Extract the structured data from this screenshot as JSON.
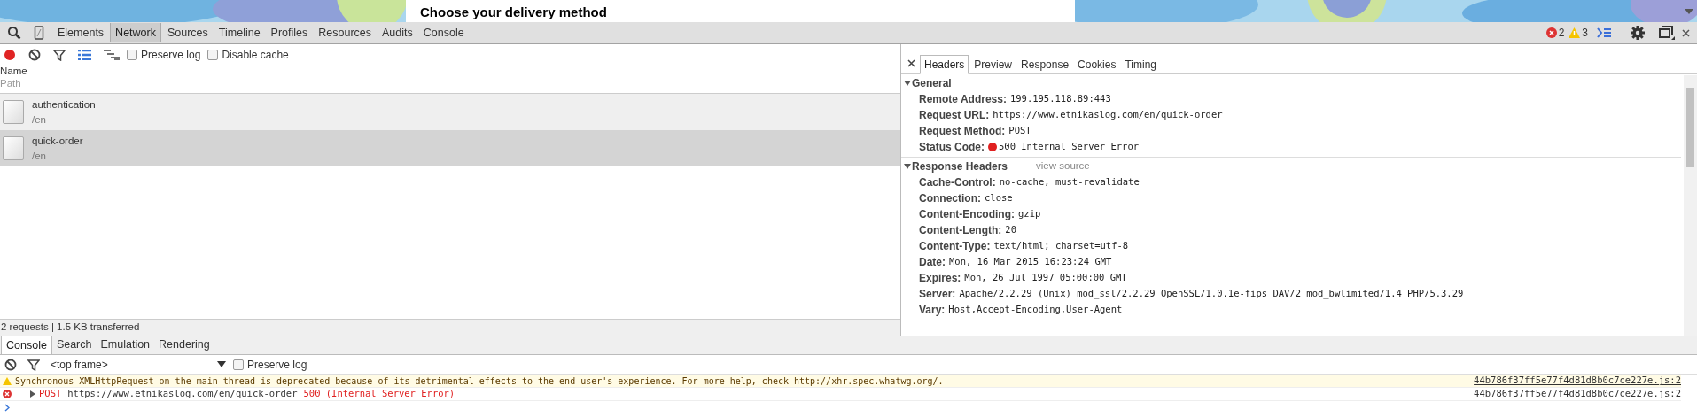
{
  "page": {
    "heading": "Choose your delivery method"
  },
  "main_tabs": [
    {
      "label": "Elements",
      "selected": false
    },
    {
      "label": "Network",
      "selected": true
    },
    {
      "label": "Sources",
      "selected": false
    },
    {
      "label": "Timeline",
      "selected": false
    },
    {
      "label": "Profiles",
      "selected": false
    },
    {
      "label": "Resources",
      "selected": false
    },
    {
      "label": "Audits",
      "selected": false
    },
    {
      "label": "Console",
      "selected": false
    }
  ],
  "counters": {
    "errors": "2",
    "warnings": "3"
  },
  "network_toolbar": {
    "recording": true,
    "options": [
      {
        "label": "Preserve log",
        "checked": false
      },
      {
        "label": "Disable cache",
        "checked": false
      }
    ]
  },
  "request_list": {
    "columns": [
      "Name",
      "Path"
    ],
    "rows": [
      {
        "name": "authentication",
        "path": "/en",
        "selected": false
      },
      {
        "name": "quick-order",
        "path": "/en",
        "selected": true
      }
    ]
  },
  "details": {
    "tabs": [
      {
        "label": "Headers",
        "selected": true
      },
      {
        "label": "Preview",
        "selected": false
      },
      {
        "label": "Response",
        "selected": false
      },
      {
        "label": "Cookies",
        "selected": false
      },
      {
        "label": "Timing",
        "selected": false
      }
    ],
    "sections": [
      {
        "title": "General",
        "expanded": true,
        "rows": [
          {
            "key": "Remote Address:",
            "value": "199.195.118.89:443"
          },
          {
            "key": "Request URL:",
            "value": "https://www.etnikaslog.com/en/quick-order"
          },
          {
            "key": "Request Method:",
            "value": "POST"
          },
          {
            "key": "Status Code:",
            "value": "500 Internal Server Error",
            "color": "#e02020"
          }
        ]
      },
      {
        "title": "Response Headers",
        "expanded": true,
        "link": "view source",
        "rows": [
          {
            "key": "Cache-Control:",
            "value": "no-cache, must-revalidate"
          },
          {
            "key": "Connection:",
            "value": "close"
          },
          {
            "key": "Content-Encoding:",
            "value": "gzip"
          },
          {
            "key": "Content-Length:",
            "value": "20"
          },
          {
            "key": "Content-Type:",
            "value": "text/html; charset=utf-8"
          },
          {
            "key": "Date:",
            "value": "Mon, 16 Mar 2015 16:23:24 GMT"
          },
          {
            "key": "Expires:",
            "value": "Mon, 26 Jul 1997 05:00:00 GMT"
          },
          {
            "key": "Server:",
            "value": "Apache/2.2.29 (Unix) mod_ssl/2.2.29 OpenSSL/1.0.1e-fips DAV/2 mod_bwlimited/1.4 PHP/5.3.29"
          },
          {
            "key": "Vary:",
            "value": "Host,Accept-Encoding,User-Agent"
          }
        ]
      }
    ]
  },
  "status_bar": "2 requests | 1.5 KB transferred",
  "drawer_tabs": [
    {
      "label": "Console",
      "selected": true
    },
    {
      "label": "Search",
      "selected": false
    },
    {
      "label": "Emulation",
      "selected": false
    },
    {
      "label": "Rendering",
      "selected": false
    }
  ],
  "console_toolbar": {
    "context": "<top frame>",
    "preserve_log": {
      "label": "Preserve log",
      "checked": false
    }
  },
  "messages": [
    {
      "kind": "warning",
      "text": "Synchronous XMLHttpRequest on the main thread is deprecated because of its detrimental effects to the end user's experience. For more help, check http://xhr.spec.whatwg.org/.",
      "source": "44b786f37ff5e77f4d81d8b0c7ce227e.js:2"
    },
    {
      "kind": "error",
      "method": "POST",
      "url": "https://www.etnikaslog.com/en/quick-order",
      "status": "500 (Internal Server Error)",
      "source": "44b786f37ff5e77f4d81d8b0c7ce227e.js:2"
    }
  ]
}
